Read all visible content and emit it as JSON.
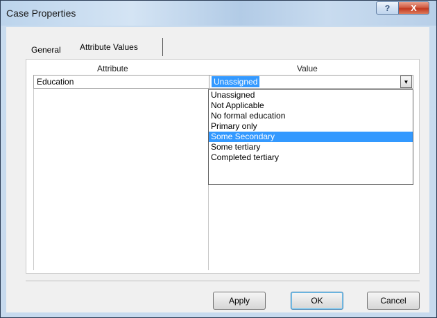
{
  "window": {
    "title": "Case Properties",
    "help_glyph": "?",
    "close_glyph": "X"
  },
  "tabs": [
    {
      "label": "General"
    },
    {
      "label": "Attribute Values"
    }
  ],
  "grid": {
    "headers": {
      "attribute": "Attribute",
      "value": "Value"
    },
    "rows": [
      {
        "attribute": "Education",
        "value": "Unassigned"
      }
    ],
    "combo_arrow_glyph": "▼"
  },
  "dropdown": {
    "options": [
      {
        "label": "Unassigned"
      },
      {
        "label": "Not Applicable"
      },
      {
        "label": "No formal education"
      },
      {
        "label": "Primary only"
      },
      {
        "label": "Some Secondary",
        "selected": true
      },
      {
        "label": "Some tertiary"
      },
      {
        "label": "Completed tertiary"
      }
    ]
  },
  "buttons": {
    "apply": "Apply",
    "ok": "OK",
    "cancel": "Cancel"
  },
  "colors": {
    "selection": "#3399ff",
    "close_button": "#c2371e"
  }
}
